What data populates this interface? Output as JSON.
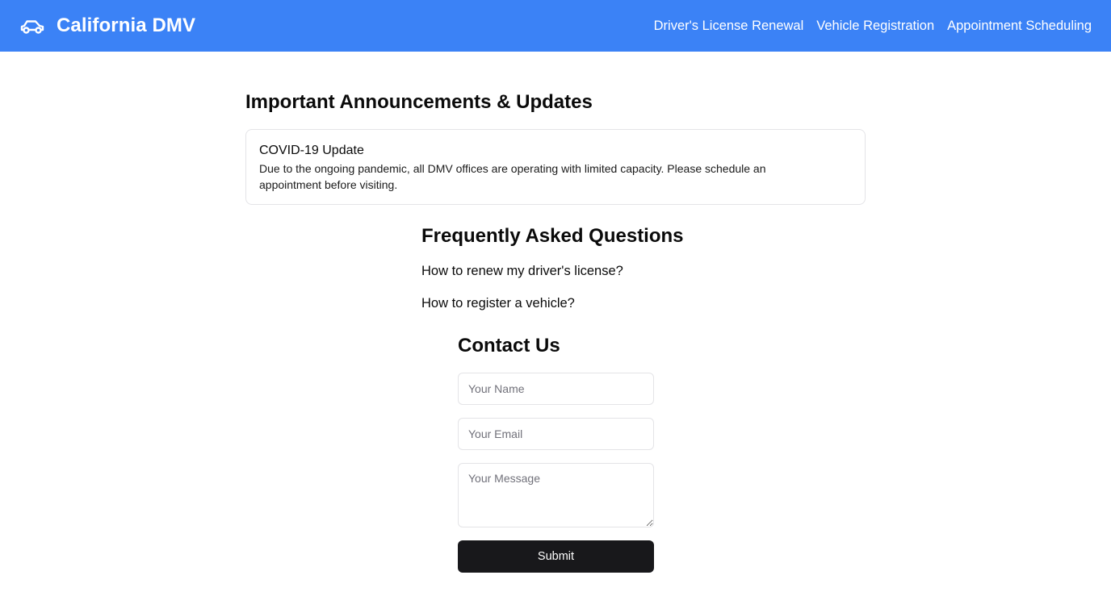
{
  "header": {
    "brand_icon": "car-icon",
    "title": "California DMV",
    "background": "#3b82f6",
    "nav": [
      {
        "label": "Driver's License Renewal"
      },
      {
        "label": "Vehicle Registration"
      },
      {
        "label": "Appointment Scheduling"
      }
    ]
  },
  "announcements": {
    "heading": "Important Announcements & Updates",
    "items": [
      {
        "title": "COVID-19 Update",
        "body": "Due to the ongoing pandemic, all DMV offices are operating with limited capacity. Please schedule an appointment before visiting."
      }
    ]
  },
  "faq": {
    "heading": "Frequently Asked Questions",
    "items": [
      {
        "question": "How to renew my driver's license?"
      },
      {
        "question": "How to register a vehicle?"
      }
    ]
  },
  "contact": {
    "heading": "Contact Us",
    "name_placeholder": "Your Name",
    "email_placeholder": "Your Email",
    "message_placeholder": "Your Message",
    "submit_label": "Submit",
    "button_color": "#18181b"
  }
}
